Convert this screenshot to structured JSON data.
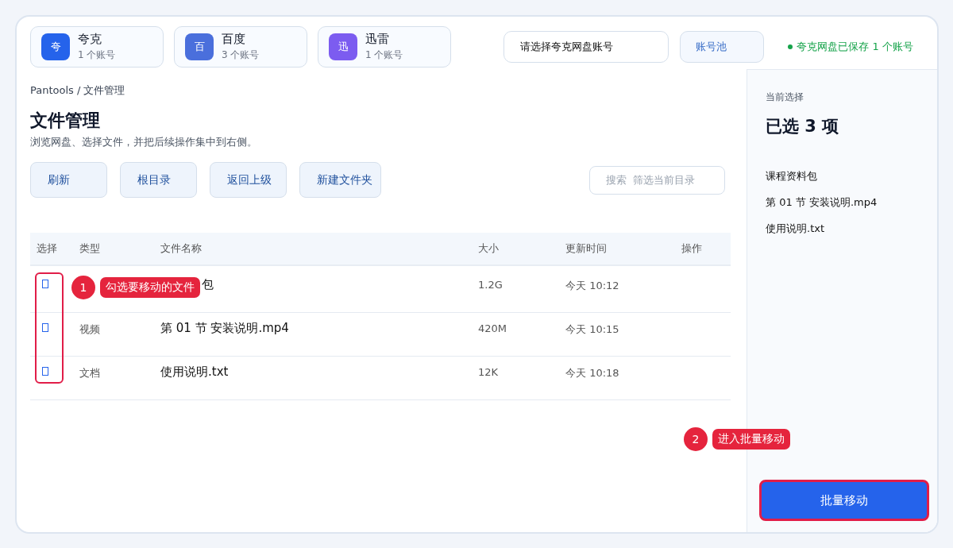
{
  "providers": [
    {
      "badge": "夸",
      "name": "夸克",
      "count": "1 个账号",
      "color": "#2563eb"
    },
    {
      "badge": "百",
      "name": "百度",
      "count": "3 个账号",
      "color": "#4a6fdc"
    },
    {
      "badge": "迅",
      "name": "迅雷",
      "count": "1 个账号",
      "color": "#7c5cf0"
    }
  ],
  "account_select": {
    "value": "请选择夸克网盘账号"
  },
  "pool_button": "账号池",
  "status": {
    "text": "夸克网盘已保存 1 个账号",
    "color": "#16a34a"
  },
  "breadcrumb": "Pantools / 文件管理",
  "title": "文件管理",
  "subtitle": "浏览网盘、选择文件，并把后续操作集中到右侧。",
  "toolbar": [
    "刷新",
    "根目录",
    "返回上级",
    "新建文件夹"
  ],
  "search": {
    "placeholder": "搜索  筛选当前目录"
  },
  "table": {
    "columns": [
      "选择",
      "类型",
      "文件名称",
      "大小",
      "更新时间",
      "操作"
    ],
    "rows": [
      {
        "checked": true,
        "type": "",
        "name": "包",
        "size": "1.2G",
        "time": "今天 10:12",
        "covered": true
      },
      {
        "checked": true,
        "type": "视频",
        "name": "第 01 节 安装说明.mp4",
        "size": "420M",
        "time": "今天 10:15",
        "covered": false
      },
      {
        "checked": true,
        "type": "文档",
        "name": "使用说明.txt",
        "size": "12K",
        "time": "今天 10:18",
        "covered": false
      }
    ]
  },
  "callouts": [
    {
      "number": "1",
      "text": "勾选要移动的文件"
    },
    {
      "number": "2",
      "text": "进入批量移动"
    }
  ],
  "panel": {
    "label": "当前选择",
    "heading": "已选 3 项",
    "items": [
      "课程资料包",
      "第 01 节 安装说明.mp4",
      "使用说明.txt"
    ],
    "action": "批量移动"
  }
}
